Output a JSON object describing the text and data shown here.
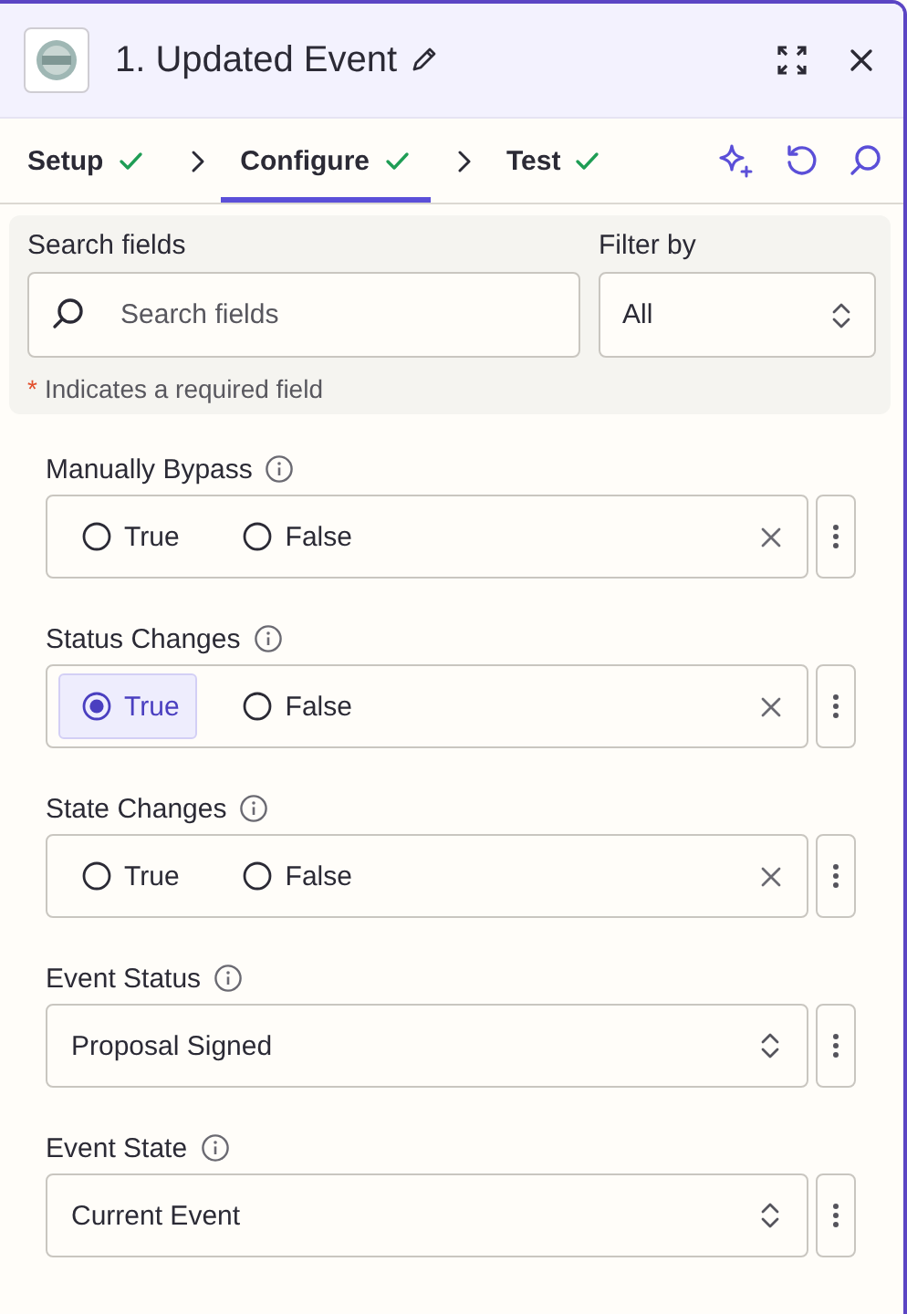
{
  "header": {
    "title": "1. Updated Event"
  },
  "steps": [
    {
      "label": "Setup",
      "selected": false,
      "complete": true
    },
    {
      "label": "Configure",
      "selected": true,
      "complete": true
    },
    {
      "label": "Test",
      "selected": false,
      "complete": true
    }
  ],
  "search": {
    "label": "Search fields",
    "placeholder": "Search fields"
  },
  "filter": {
    "label": "Filter by",
    "value": "All"
  },
  "required_note": {
    "mark": "*",
    "text": "Indicates a required field"
  },
  "fields": [
    {
      "kind": "radio",
      "label": "Manually Bypass",
      "options": [
        {
          "label": "True",
          "selected": false
        },
        {
          "label": "False",
          "selected": false
        }
      ]
    },
    {
      "kind": "radio",
      "label": "Status Changes",
      "options": [
        {
          "label": "True",
          "selected": true
        },
        {
          "label": "False",
          "selected": false
        }
      ]
    },
    {
      "kind": "radio",
      "label": "State Changes",
      "options": [
        {
          "label": "True",
          "selected": false
        },
        {
          "label": "False",
          "selected": false
        }
      ]
    },
    {
      "kind": "select",
      "label": "Event Status",
      "value": "Proposal Signed"
    },
    {
      "kind": "select",
      "label": "Event State",
      "value": "Current Event"
    }
  ]
}
